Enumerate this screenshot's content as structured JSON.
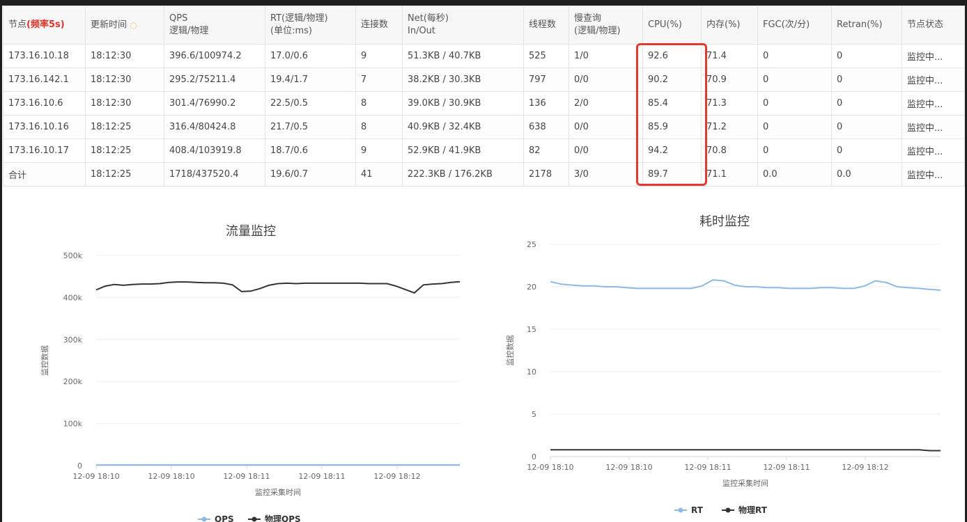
{
  "table": {
    "headers": [
      {
        "line1": "节点",
        "line1_paren": "(频率5s)",
        "line2": ""
      },
      {
        "line1": "更新时间",
        "line2": ""
      },
      {
        "line1": "QPS",
        "line2": "逻辑/物理"
      },
      {
        "line1": "RT(逻辑/物理)",
        "line2": "(单位:ms)"
      },
      {
        "line1": "连接数",
        "line2": ""
      },
      {
        "line1": "Net(每秒)",
        "line2": "In/Out"
      },
      {
        "line1": "线程数",
        "line2": ""
      },
      {
        "line1": "慢查询",
        "line2": "(逻辑/物理)"
      },
      {
        "line1": "CPU(%)",
        "line2": ""
      },
      {
        "line1": "内存(%)",
        "line2": ""
      },
      {
        "line1": "FGC(次/分)",
        "line2": ""
      },
      {
        "line1": "Retran(%)",
        "line2": ""
      },
      {
        "line1": "节点状态",
        "line2": ""
      }
    ],
    "rows": [
      {
        "node": "173.16.10.18",
        "time": "18:12:30",
        "qps": "396.6/100974.2",
        "rt": "17.0/0.6",
        "conn": "9",
        "net": "51.3KB / 40.7KB",
        "threads": "525",
        "slow": "1/0",
        "cpu": "92.6",
        "mem": "71.4",
        "fgc": "0",
        "retran": "0",
        "status": "监控中..."
      },
      {
        "node": "173.16.142.1",
        "time": "18:12:30",
        "qps": "295.2/75211.4",
        "rt": "19.4/1.7",
        "conn": "7",
        "net": "38.2KB / 30.3KB",
        "threads": "797",
        "slow": "0/0",
        "cpu": "90.2",
        "mem": "70.9",
        "fgc": "0",
        "retran": "0",
        "status": "监控中..."
      },
      {
        "node": "173.16.10.6",
        "time": "18:12:30",
        "qps": "301.4/76990.2",
        "rt": "22.5/0.5",
        "conn": "8",
        "net": "39.0KB / 30.9KB",
        "threads": "136",
        "slow": "2/0",
        "cpu": "85.4",
        "mem": "71.3",
        "fgc": "0",
        "retran": "0",
        "status": "监控中..."
      },
      {
        "node": "173.16.10.16",
        "time": "18:12:25",
        "qps": "316.4/80424.8",
        "rt": "21.7/0.5",
        "conn": "8",
        "net": "40.9KB / 32.4KB",
        "threads": "638",
        "slow": "0/0",
        "cpu": "85.9",
        "mem": "71.2",
        "fgc": "0",
        "retran": "0",
        "status": "监控中..."
      },
      {
        "node": "173.16.10.17",
        "time": "18:12:25",
        "qps": "408.4/103919.8",
        "rt": "18.7/0.6",
        "conn": "9",
        "net": "52.9KB / 41.9KB",
        "threads": "82",
        "slow": "0/0",
        "cpu": "94.2",
        "mem": "70.8",
        "fgc": "0",
        "retran": "0",
        "status": "监控中..."
      },
      {
        "node": "合计",
        "time": "18:12:25",
        "qps": "1718/437520.4",
        "rt": "19.6/0.7",
        "conn": "41",
        "net": "222.3KB / 176.2KB",
        "threads": "2178",
        "slow": "3/0",
        "cpu": "89.7",
        "mem": "71.1",
        "fgc": "0.0",
        "retran": "0.0",
        "status": "监控中..."
      }
    ]
  },
  "colors": {
    "accent_red": "#e0342b",
    "link_blue": "#3b79c3",
    "time_blue": "#2f55c8",
    "status_green": "#3aa63a",
    "series_light": "#8fb8e6",
    "series_dark": "#333333",
    "highlight": "#e23b2e"
  },
  "chart_data": [
    {
      "type": "line",
      "title": "流量监控",
      "xlabel": "监控采集时间",
      "ylabel": "监控数据",
      "x_ticks": [
        "12-09 18:10",
        "12-09 18:10",
        "12-09 18:11",
        "12-09 18:11",
        "12-09 18:12"
      ],
      "y_ticks": [
        "0",
        "100k",
        "200k",
        "300k",
        "400k",
        "500k"
      ],
      "ylim": [
        0,
        500000
      ],
      "grid": true,
      "legend": "bottom",
      "series": [
        {
          "name": "QPS",
          "color": "#8fb8e6",
          "values": [
            1500,
            1600,
            1700,
            1650,
            1700,
            1750,
            1700,
            1650,
            1700,
            1720,
            1700,
            1690,
            1710,
            1700,
            1720,
            1700,
            1690,
            1700,
            1710,
            1700,
            1700,
            1720,
            1710,
            1700,
            1700,
            1690,
            1700,
            1710,
            1700,
            1700,
            1710,
            1700,
            1700,
            1720,
            1700,
            1700,
            1710,
            1700,
            1700,
            1700,
            1718
          ]
        },
        {
          "name": "物理QPS",
          "color": "#333333",
          "values": [
            418000,
            427000,
            431000,
            429000,
            431000,
            432000,
            432000,
            433000,
            436000,
            437000,
            437000,
            436000,
            435000,
            435000,
            434000,
            430000,
            414000,
            415000,
            421000,
            429000,
            433000,
            434000,
            433000,
            434000,
            434000,
            434000,
            434000,
            434000,
            434000,
            434000,
            433000,
            433000,
            433000,
            427000,
            419000,
            411000,
            430000,
            432000,
            433000,
            436000,
            437520
          ]
        }
      ]
    },
    {
      "type": "line",
      "title": "耗时监控",
      "xlabel": "监控采集时间",
      "ylabel": "监控数据",
      "x_ticks": [
        "12-09 18:10",
        "12-09 18:10",
        "12-09 18:11",
        "12-09 18:11",
        "12-09 18:12"
      ],
      "y_ticks": [
        "0",
        "5",
        "10",
        "15",
        "20",
        "25"
      ],
      "ylim": [
        0,
        25
      ],
      "grid": true,
      "legend": "bottom",
      "series": [
        {
          "name": "RT",
          "color": "#8fb8e6",
          "values": [
            20.6,
            20.3,
            20.2,
            20.1,
            20.1,
            20.0,
            20.0,
            19.9,
            19.8,
            19.8,
            19.8,
            19.8,
            19.8,
            19.8,
            20.1,
            20.8,
            20.7,
            20.2,
            20.0,
            20.0,
            19.9,
            19.9,
            19.8,
            19.8,
            19.8,
            19.9,
            19.9,
            19.8,
            19.8,
            20.1,
            20.7,
            20.5,
            20.0,
            19.9,
            19.8,
            19.7,
            19.6
          ]
        },
        {
          "name": "物理RT",
          "color": "#333333",
          "values": [
            0.8,
            0.8,
            0.8,
            0.8,
            0.8,
            0.8,
            0.8,
            0.8,
            0.8,
            0.8,
            0.8,
            0.8,
            0.8,
            0.8,
            0.8,
            0.8,
            0.8,
            0.8,
            0.8,
            0.8,
            0.8,
            0.8,
            0.8,
            0.8,
            0.8,
            0.8,
            0.8,
            0.8,
            0.8,
            0.8,
            0.8,
            0.8,
            0.8,
            0.8,
            0.8,
            0.7,
            0.7
          ]
        }
      ]
    }
  ]
}
